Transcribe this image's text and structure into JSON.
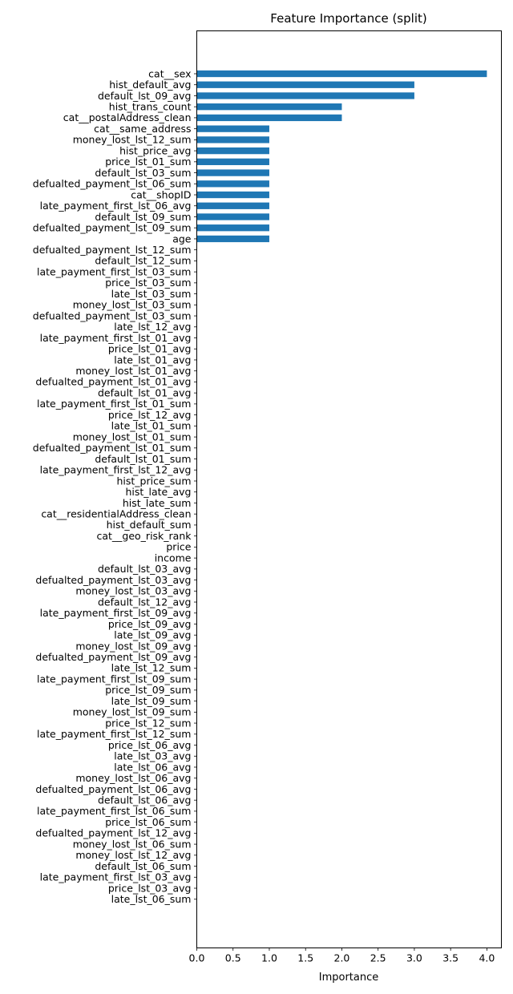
{
  "chart_data": {
    "type": "bar",
    "orientation": "horizontal",
    "title": "Feature Importance (split)",
    "xlabel": "Importance",
    "ylabel": "",
    "xlim": [
      0,
      4.2
    ],
    "xticks": [
      "0.0",
      "0.5",
      "1.0",
      "1.5",
      "2.0",
      "2.5",
      "3.0",
      "3.5",
      "4.0"
    ],
    "bar_color": "#1f77b4",
    "grid": false,
    "categories": [
      "cat__sex",
      "hist_default_avg",
      "default_lst_09_avg",
      "hist_trans_count",
      "cat__postalAddress_clean",
      "cat__same_address",
      "money_lost_lst_12_sum",
      "hist_price_avg",
      "price_lst_01_sum",
      "default_lst_03_sum",
      "defualted_payment_lst_06_sum",
      "cat__shopID",
      "late_payment_first_lst_06_avg",
      "default_lst_09_sum",
      "defualted_payment_lst_09_sum",
      "age",
      "defualted_payment_lst_12_sum",
      "default_lst_12_sum",
      "late_payment_first_lst_03_sum",
      "price_lst_03_sum",
      "late_lst_03_sum",
      "money_lost_lst_03_sum",
      "defualted_payment_lst_03_sum",
      "late_lst_12_avg",
      "late_payment_first_lst_01_avg",
      "price_lst_01_avg",
      "late_lst_01_avg",
      "money_lost_lst_01_avg",
      "defualted_payment_lst_01_avg",
      "default_lst_01_avg",
      "late_payment_first_lst_01_sum",
      "price_lst_12_avg",
      "late_lst_01_sum",
      "money_lost_lst_01_sum",
      "defualted_payment_lst_01_sum",
      "default_lst_01_sum",
      "late_payment_first_lst_12_avg",
      "hist_price_sum",
      "hist_late_avg",
      "hist_late_sum",
      "cat__residentialAddress_clean",
      "hist_default_sum",
      "cat__geo_risk_rank",
      "price",
      "income",
      "default_lst_03_avg",
      "defualted_payment_lst_03_avg",
      "money_lost_lst_03_avg",
      "default_lst_12_avg",
      "late_payment_first_lst_09_avg",
      "price_lst_09_avg",
      "late_lst_09_avg",
      "money_lost_lst_09_avg",
      "defualted_payment_lst_09_avg",
      "late_lst_12_sum",
      "late_payment_first_lst_09_sum",
      "price_lst_09_sum",
      "late_lst_09_sum",
      "money_lost_lst_09_sum",
      "price_lst_12_sum",
      "late_payment_first_lst_12_sum",
      "price_lst_06_avg",
      "late_lst_03_avg",
      "late_lst_06_avg",
      "money_lost_lst_06_avg",
      "defualted_payment_lst_06_avg",
      "default_lst_06_avg",
      "late_payment_first_lst_06_sum",
      "price_lst_06_sum",
      "defualted_payment_lst_12_avg",
      "money_lost_lst_06_sum",
      "money_lost_lst_12_avg",
      "default_lst_06_sum",
      "late_payment_first_lst_03_avg",
      "price_lst_03_avg",
      "late_lst_06_sum"
    ],
    "values": [
      4,
      3,
      3,
      2,
      2,
      1,
      1,
      1,
      1,
      1,
      1,
      1,
      1,
      1,
      1,
      1,
      0,
      0,
      0,
      0,
      0,
      0,
      0,
      0,
      0,
      0,
      0,
      0,
      0,
      0,
      0,
      0,
      0,
      0,
      0,
      0,
      0,
      0,
      0,
      0,
      0,
      0,
      0,
      0,
      0,
      0,
      0,
      0,
      0,
      0,
      0,
      0,
      0,
      0,
      0,
      0,
      0,
      0,
      0,
      0,
      0,
      0,
      0,
      0,
      0,
      0,
      0,
      0,
      0,
      0,
      0,
      0,
      0,
      0,
      0,
      0
    ]
  }
}
